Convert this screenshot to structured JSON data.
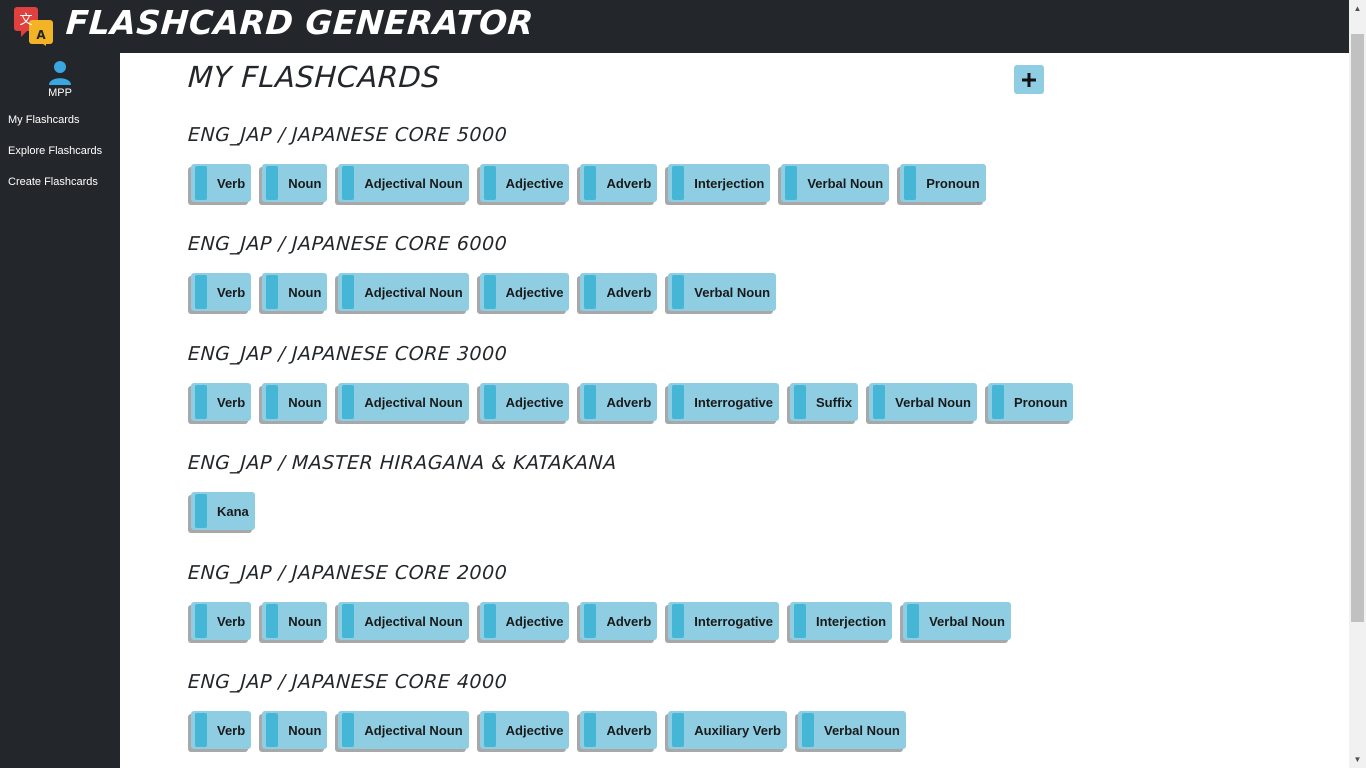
{
  "app": {
    "title": "FLASHCARD GENERATOR"
  },
  "user": {
    "name": "MPP"
  },
  "sidebar": {
    "items": [
      {
        "label": "My Flashcards"
      },
      {
        "label": "Explore Flashcards"
      },
      {
        "label": "Create Flashcards"
      }
    ]
  },
  "main": {
    "title": "MY FLASHCARDS",
    "add_icon": "plus-icon",
    "decks": [
      {
        "title": "ENG_JAP / JAPANESE CORE 5000",
        "cards": [
          "Verb",
          "Noun",
          "Adjectival Noun",
          "Adjective",
          "Adverb",
          "Interjection",
          "Verbal Noun",
          "Pronoun"
        ]
      },
      {
        "title": "ENG_JAP / JAPANESE CORE 6000",
        "cards": [
          "Verb",
          "Noun",
          "Adjectival Noun",
          "Adjective",
          "Adverb",
          "Verbal Noun"
        ]
      },
      {
        "title": "ENG_JAP / JAPANESE CORE 3000",
        "cards": [
          "Verb",
          "Noun",
          "Adjectival Noun",
          "Adjective",
          "Adverb",
          "Interrogative",
          "Suffix",
          "Verbal Noun",
          "Pronoun"
        ]
      },
      {
        "title": "ENG_JAP / MASTER HIRAGANA & KATAKANA",
        "cards": [
          "Kana"
        ]
      },
      {
        "title": "ENG_JAP / JAPANESE CORE 2000",
        "cards": [
          "Verb",
          "Noun",
          "Adjectival Noun",
          "Adjective",
          "Adverb",
          "Interrogative",
          "Interjection",
          "Verbal Noun"
        ]
      },
      {
        "title": "ENG_JAP / JAPANESE CORE 4000",
        "cards": [
          "Verb",
          "Noun",
          "Adjectival Noun",
          "Adjective",
          "Adverb",
          "Auxiliary Verb",
          "Verbal Noun"
        ]
      }
    ]
  },
  "colors": {
    "dark": "#23272b",
    "card": "#8ecde2",
    "card_tab": "#45b6d6"
  }
}
